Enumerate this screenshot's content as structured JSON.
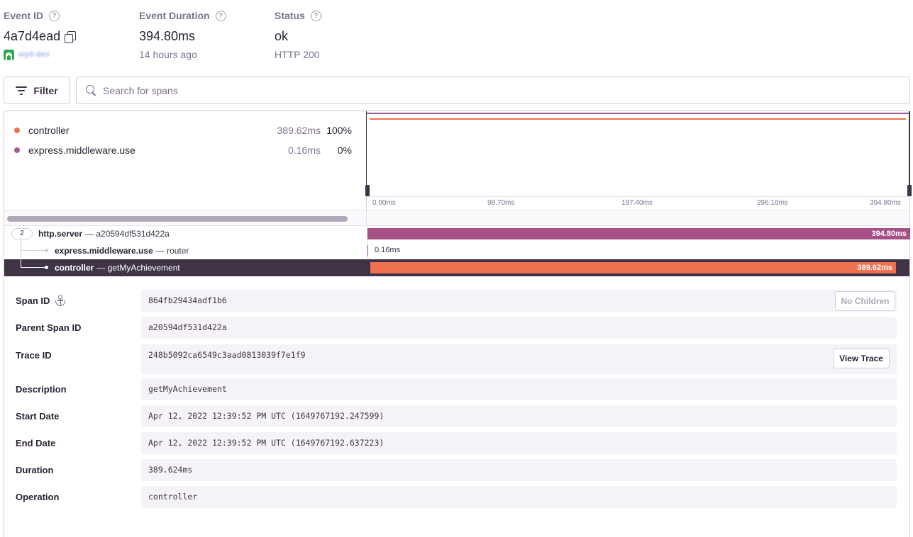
{
  "header": {
    "event_id_label": "Event ID",
    "event_id": "4a7d4ead",
    "project_name": "wyd-dev",
    "duration_label": "Event Duration",
    "duration": "394.80ms",
    "time_ago": "14 hours ago",
    "status_label": "Status",
    "status": "ok",
    "http_status": "HTTP 200"
  },
  "toolbar": {
    "filter_label": "Filter",
    "search_placeholder": "Search for spans"
  },
  "ops_breakdown": [
    {
      "name": "controller",
      "duration": "389.62ms",
      "percent": "100%",
      "color": "#e9734f"
    },
    {
      "name": "express.middleware.use",
      "duration": "0.16ms",
      "percent": "0%",
      "color": "#9c5f9a"
    }
  ],
  "axis_ticks": [
    "0.00ms",
    "98.70ms",
    "197.40ms",
    "296.10ms",
    "394.80ms"
  ],
  "spans": [
    {
      "children": "2",
      "op": "http.server",
      "desc": "— a20594df531d422a",
      "bar_label": "394.80ms",
      "fraction": 1.0,
      "color": "#a55087"
    },
    {
      "op": "express.middleware.use",
      "desc": "— router",
      "bar_label": "0.16ms",
      "fraction": 0.0004,
      "color": "#9c5f9a"
    },
    {
      "op": "controller",
      "desc": "— getMyAchievement",
      "bar_label": "389.62ms",
      "fraction": 0.9869,
      "color": "#f0714f"
    }
  ],
  "details": {
    "span_id_label": "Span ID",
    "span_id": "864fb29434adf1b6",
    "no_children": "No Children",
    "parent_label": "Parent Span ID",
    "parent_id": "a20594df531d422a",
    "trace_label": "Trace ID",
    "trace_id": "248b5092ca6549c3aad0813039f7e1f9",
    "view_trace": "View Trace",
    "description_label": "Description",
    "description": "getMyAchievement",
    "start_label": "Start Date",
    "start_date": "Apr 12, 2022 12:39:52 PM UTC (1649767192.247599)",
    "end_label": "End Date",
    "end_date": "Apr 12, 2022 12:39:52 PM UTC (1649767192.637223)",
    "duration_label": "Duration",
    "duration": "389.624ms",
    "operation_label": "Operation",
    "operation": "controller"
  }
}
